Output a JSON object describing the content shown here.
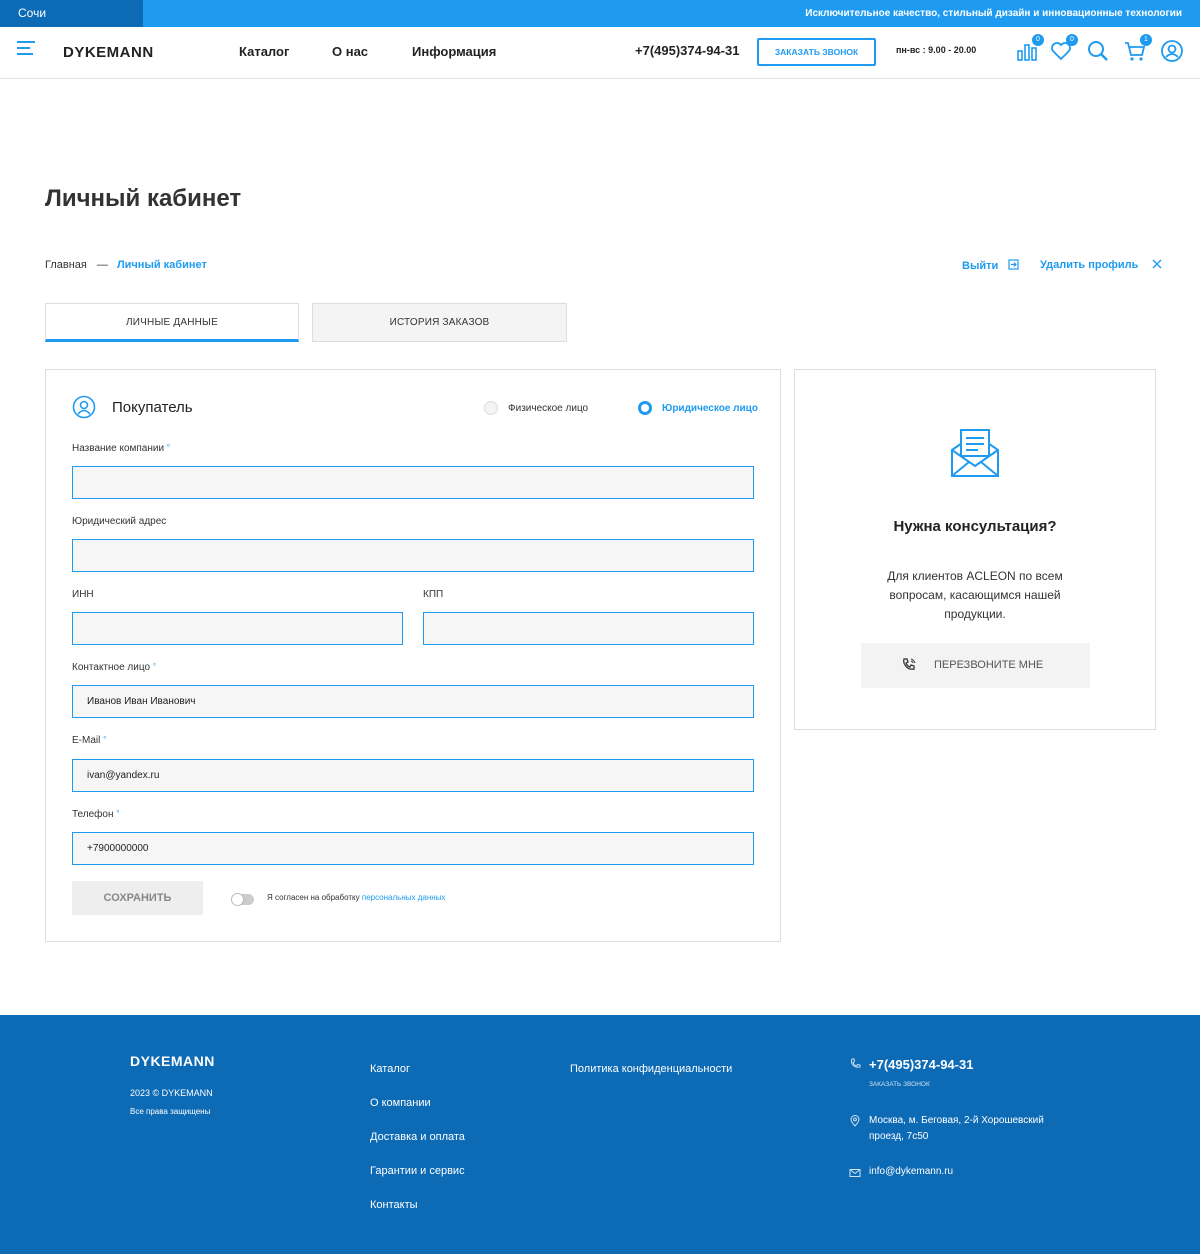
{
  "topbar": {
    "city": "Сочи",
    "slogan": "Исключительное качество, стильный дизайн и инновационные технологии"
  },
  "header": {
    "logo": "DYKEMANN",
    "nav": [
      "Каталог",
      "О нас",
      "Информация"
    ],
    "phone": "+7(495)374-94-31",
    "call_button": "ЗАКАЗАТЬ ЗВОНОК",
    "hours": "пн-вс : 9.00 - 20.00",
    "compare_count": "0",
    "favorites_count": "0",
    "cart_count": "1"
  },
  "page_title": "Личный кабинет",
  "breadcrumb": {
    "home": "Главная",
    "separator": "—",
    "current": "Личный кабинет"
  },
  "actions": {
    "logout": "Выйти",
    "delete_profile": "Удалить профиль"
  },
  "tabs": [
    "ЛИЧНЫЕ ДАННЫЕ",
    "ИСТОРИЯ ЗАКАЗОВ"
  ],
  "form": {
    "title": "Покупатель",
    "radio_individual": "Физическое лицо",
    "radio_legal": "Юридическое лицо",
    "fields": {
      "company": {
        "label": "Название компании",
        "value": ""
      },
      "address": {
        "label": "Юридический адрес",
        "value": ""
      },
      "inn": {
        "label": "ИНН",
        "value": ""
      },
      "kpp": {
        "label": "КПП",
        "value": ""
      },
      "contact": {
        "label": "Контактное лицо",
        "value": "Иванов Иван Иванович"
      },
      "email": {
        "label": "E-Mail",
        "value": "ivan@yandex.ru"
      },
      "phone": {
        "label": "Телефон",
        "value": "+7900000000"
      }
    },
    "required_mark": "°",
    "save": "СОХРАНИТЬ",
    "consent_text": "Я согласен на обработку",
    "consent_link": "персональных данных"
  },
  "consult": {
    "title": "Нужна консультация?",
    "text": "Для клиентов ACLEON по всем вопросам, касающимся нашей продукции.",
    "button": "ПЕРЕЗВОНИТЕ МНЕ"
  },
  "footer": {
    "logo": "DYKEMANN",
    "copyright": "2023 © DYKEMANN",
    "rights": "Все права защищены",
    "links": [
      "Каталог",
      "О компании",
      "Доставка и оплата",
      "Гарантии и сервис",
      "Контакты"
    ],
    "privacy": "Политика конфиденциальности",
    "phone": "+7(495)374-94-31",
    "call": "ЗАКАЗАТЬ ЗВОНОК",
    "address": "Москва, м. Беговая, 2-й Хорошевский проезд, 7с50",
    "email": "info@dykemann.ru"
  },
  "colors": {
    "accent": "#1e9bf0",
    "footer": "#0d6ab5"
  }
}
